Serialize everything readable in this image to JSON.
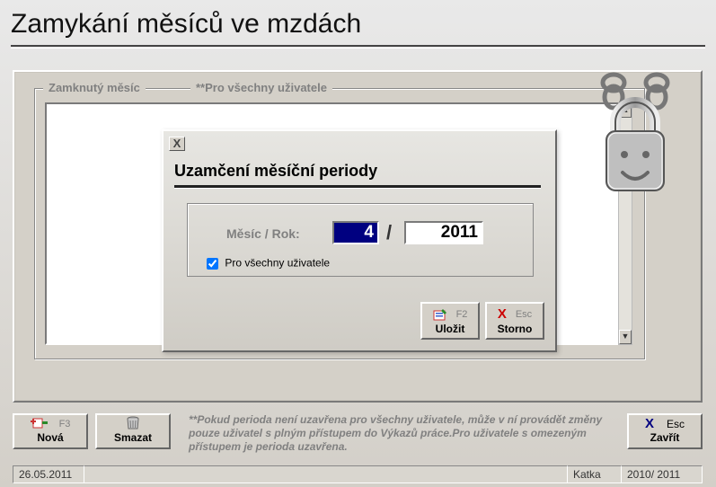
{
  "page": {
    "title": "Zamykání měsíců ve mzdách"
  },
  "group": {
    "caption": "Zamknutý měsíc",
    "caption2": "**Pro všechny uživatele"
  },
  "dialog": {
    "title": "Uzamčení měsíční periody",
    "close_x": "X",
    "month_year_label": "Měsíc / Rok:",
    "month_value": "4",
    "slash": "/",
    "year_value": "2011",
    "checkbox_label": "Pro všechny uživatele",
    "checkbox_checked": true,
    "save": {
      "hotkey": "F2",
      "label": "Uložit"
    },
    "cancel": {
      "hotkey": "Esc",
      "label": "Storno",
      "icon": "X"
    }
  },
  "bottom": {
    "new": {
      "hotkey": "F3",
      "label": "Nová"
    },
    "delete": {
      "label": "Smazat"
    },
    "hint": "**Pokud perioda není uzavřena pro všechny uživatele, může v ní provádět změny pouze uživatel s plným přístupem do Výkazů práce.Pro uživatele s omezeným přístupem je perioda uzavřena.",
    "close": {
      "hotkey": "Esc",
      "label": "Zavřít",
      "icon": "X"
    }
  },
  "status": {
    "date": "26.05.2011",
    "user": "Katka",
    "period": "2010/ 2011"
  },
  "scroll": {
    "up": "▲",
    "down": "▼"
  }
}
